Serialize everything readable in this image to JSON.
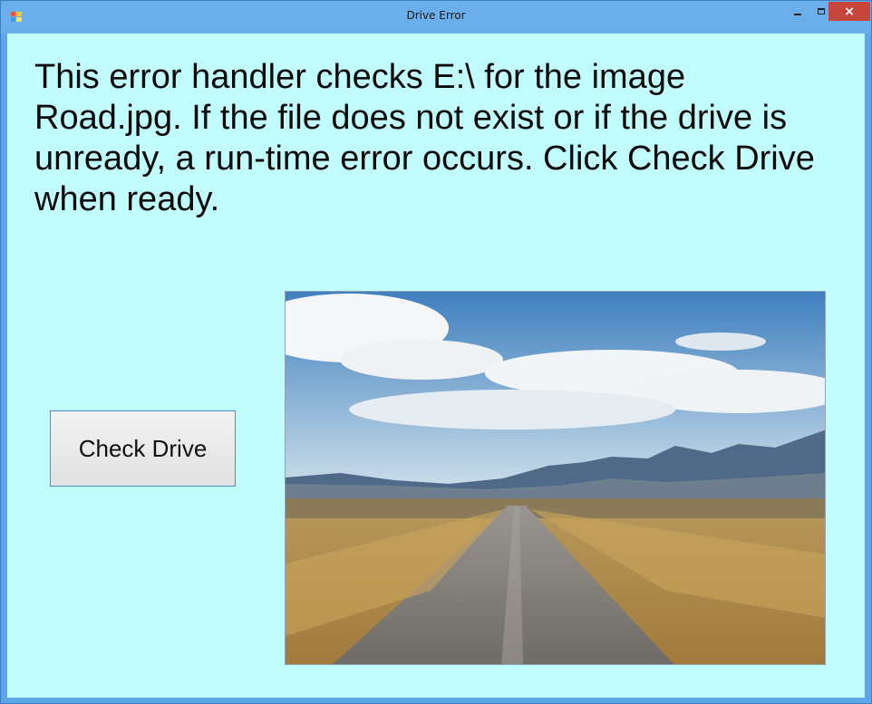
{
  "window": {
    "title": "Drive Error",
    "controls": {
      "minimize_icon": "minimize-icon",
      "maximize_icon": "maximize-icon",
      "close_glyph": "×"
    },
    "colors": {
      "titlebar": "#6aaeec",
      "client_background": "#c2fdfd",
      "close_button": "#c7463c"
    }
  },
  "main": {
    "message": "This error handler checks E:\\ for the image Road.jpg. If the file does not exist or if the drive is unready, a run-time error occurs. Click Check Drive when ready.",
    "check_button_label": "Check Drive",
    "picture_description_icon": "road-landscape-image"
  }
}
